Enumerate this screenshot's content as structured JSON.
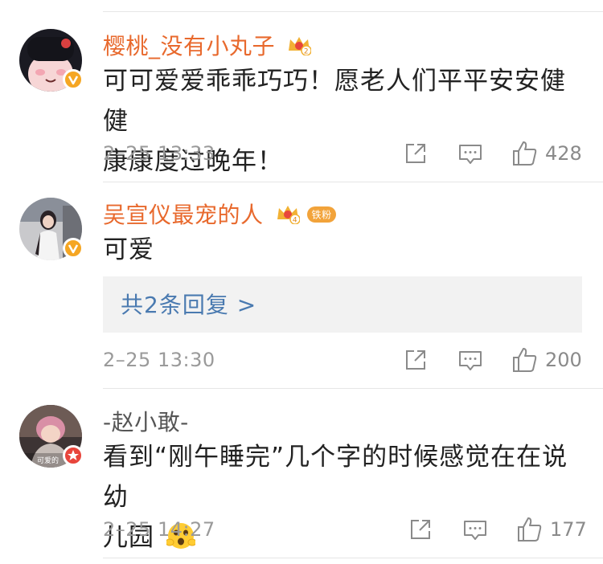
{
  "comments": [
    {
      "username": "樱桃_没有小丸子",
      "text_line1": "可可爱爱乖乖巧巧！愿老人们平平安安健健",
      "text_line2": "康康度过晚年！",
      "time": "2–25 13:33",
      "likes": "428",
      "crown_level": "2",
      "verified_color": "#f5a623"
    },
    {
      "username": "吴宣仪最宠的人",
      "text_line1": "可爱",
      "reply_link": "共2条回复 >",
      "time": "2–25 13:30",
      "likes": "200",
      "crown_level": "4",
      "fan_tag": "铁粉",
      "verified_color": "#f5a623"
    },
    {
      "username": "-赵小敢-",
      "text_line1": "看到“刚午睡完”几个字的时候感觉在在说幼",
      "text_line2": "儿园",
      "time": "2–25 14:27",
      "likes": "177",
      "avatar_caption": "可爱的",
      "verified_color": "#e8453c"
    }
  ],
  "icons": {
    "share": "share-icon",
    "reply": "comment-icon",
    "like": "thumbs-up-icon",
    "emoji": "surprised-emoji-icon",
    "crown": "crown-icon"
  },
  "colors": {
    "username_accent": "#e8692d",
    "link": "#4a7ab0",
    "meta": "#9a9a9a"
  }
}
